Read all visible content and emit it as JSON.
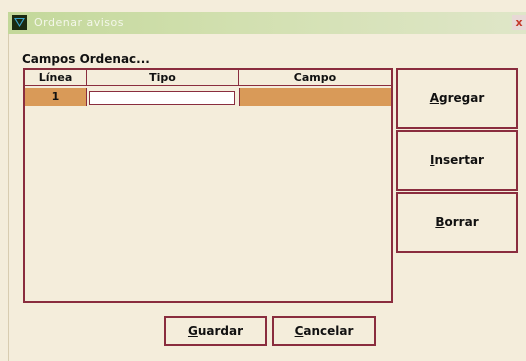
{
  "window": {
    "title": "Ordenar avisos",
    "close_glyph": "x",
    "icon": "app-logo-icon"
  },
  "section": {
    "label": "Campos Ordenac..."
  },
  "table": {
    "columns": [
      "Línea",
      "Tipo",
      "Campo"
    ],
    "rows": [
      {
        "linea": "1",
        "tipo": "",
        "campo": ""
      }
    ]
  },
  "buttons": {
    "agregar": {
      "mnemonic": "A",
      "rest": "gregar"
    },
    "insertar": {
      "mnemonic": "I",
      "rest": "nsertar"
    },
    "borrar": {
      "mnemonic": "B",
      "rest": "orrar"
    },
    "guardar": {
      "mnemonic": "G",
      "rest": "uardar"
    },
    "cancelar": {
      "mnemonic": "C",
      "rest": "ancelar"
    }
  },
  "colors": {
    "border": "#8a2d3e",
    "selection": "#d99a58",
    "background": "#f4eddb",
    "titlebar": "#c3d89a"
  }
}
